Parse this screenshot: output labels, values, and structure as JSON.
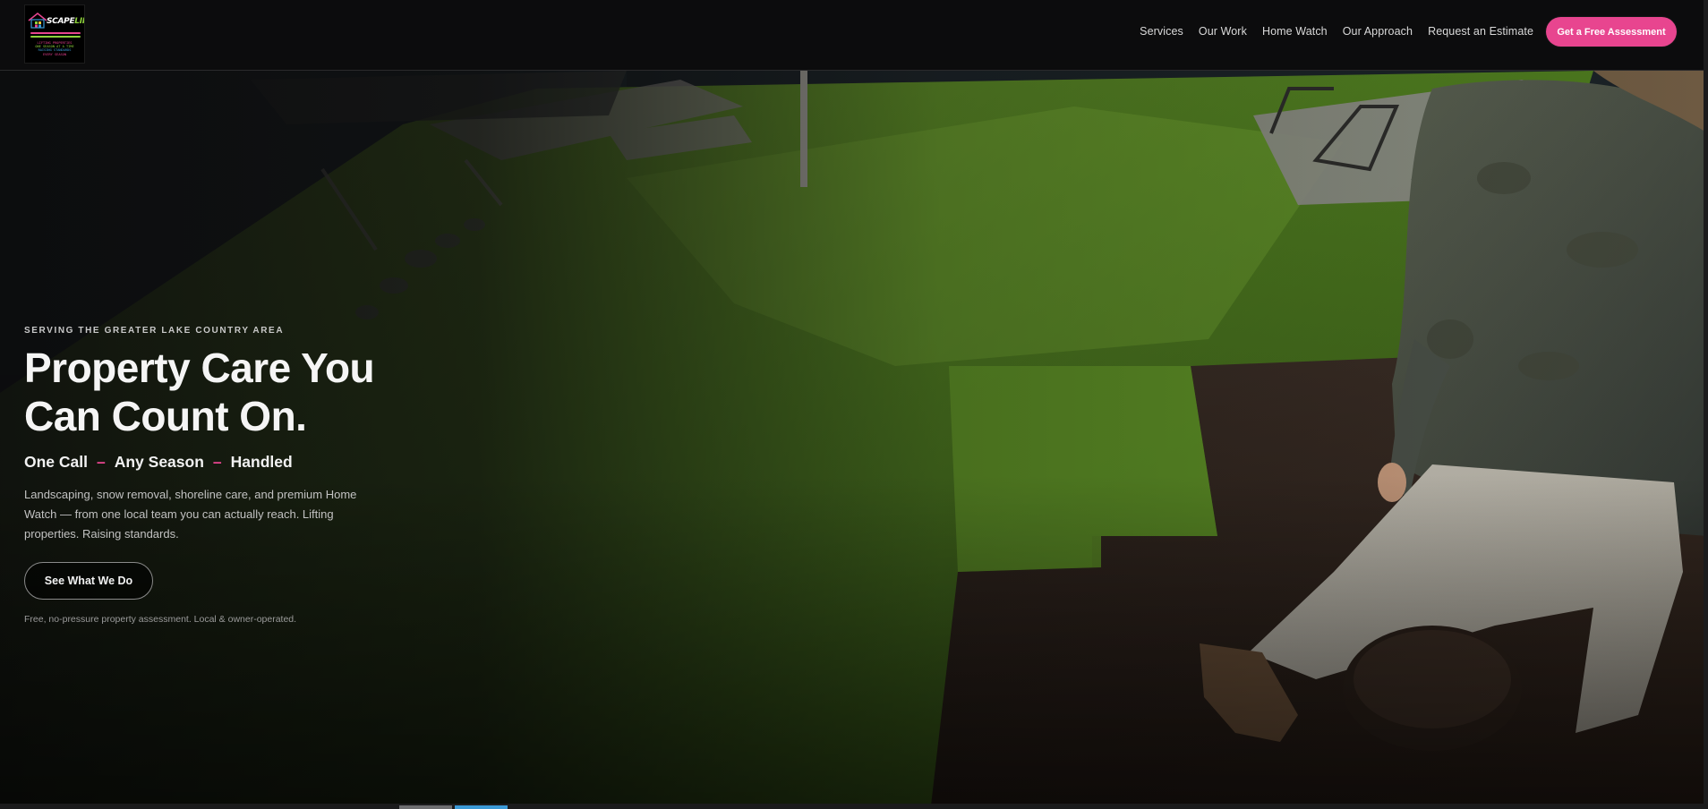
{
  "header": {
    "logo": {
      "brand_scape": "SCAPE",
      "brand_lift": "LIFT",
      "tagline_lines": [
        "LIFTING PROPERTIES",
        "ONE SEASON AT A TIME",
        "RAISING STANDARDS",
        "EVERY SEASON"
      ]
    },
    "nav": [
      {
        "label": "Services"
      },
      {
        "label": "Our Work"
      },
      {
        "label": "Home Watch"
      },
      {
        "label": "Our Approach"
      },
      {
        "label": "Request an Estimate"
      }
    ],
    "cta_label": "Get a Free Assessment"
  },
  "hero": {
    "eyebrow": "SERVING THE GREATER LAKE COUNTRY AREA",
    "headline_line1": "Property Care You",
    "headline_line2": "Can Count On.",
    "tagline": [
      "One Call",
      "Any Season",
      "Handled"
    ],
    "tagline_separator": "–",
    "description": "Landscaping, snow removal, shoreline care, and premium Home Watch — from one local team you can actually reach. Lifting properties. Raising standards.",
    "button_label": "See What We Do",
    "note": "Free, no-pressure property assessment. Local & owner-operated."
  },
  "colors": {
    "accent": "#e8458f",
    "brand_green": "#8ed13b",
    "header_bg": "#0c0c0d"
  }
}
